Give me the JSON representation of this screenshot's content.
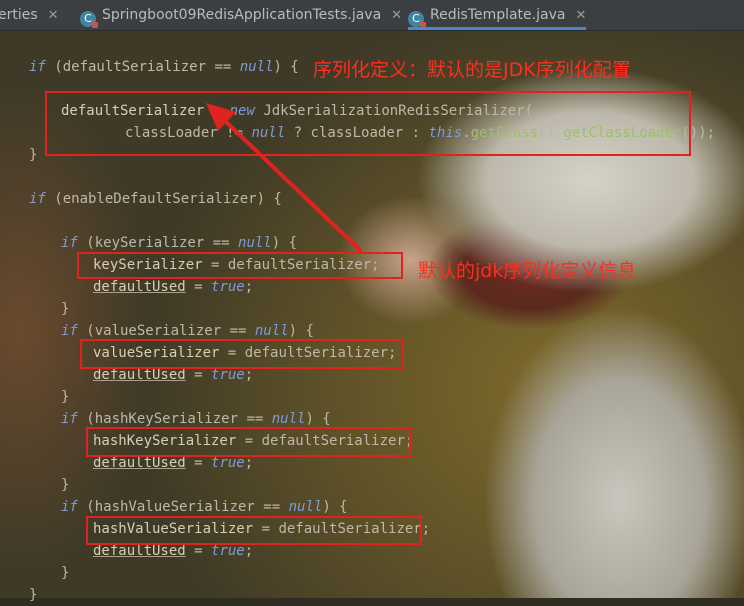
{
  "tabs": [
    {
      "label": "erties",
      "close": "✕"
    },
    {
      "label": "Springboot09RedisApplicationTests.java",
      "close": "✕",
      "icon": "C"
    },
    {
      "label": "RedisTemplate.java",
      "close": "✕",
      "icon": "C",
      "active": true
    }
  ],
  "code": {
    "l1": [
      "if",
      " (defaultSerializer ",
      "==",
      " ",
      "null",
      ") {"
    ],
    "l2": [
      "defaultSerializer",
      " = ",
      "new",
      " JdkSerializationRedisSerializer("
    ],
    "l3": [
      "classLoader",
      " ",
      "!=",
      " ",
      "null",
      " ? classLoader : ",
      "this",
      ".",
      "getClass",
      "().",
      "getClassLoader",
      "());"
    ],
    "l4": "}",
    "l5": [
      "if",
      " (enableDefaultSerializer) {"
    ],
    "l6": [
      "if",
      " (keySerializer ",
      "==",
      " ",
      "null",
      ") {"
    ],
    "l7": [
      "keySerializer",
      " = defaultSerializer;"
    ],
    "l8": [
      "defaultUsed",
      " = ",
      "true",
      ";"
    ],
    "l9": "}",
    "l10": [
      "if",
      " (valueSerializer ",
      "==",
      " ",
      "null",
      ") {"
    ],
    "l11": [
      "valueSerializer",
      " = defaultSerializer;"
    ],
    "l12": [
      "defaultUsed",
      " = ",
      "true",
      ";"
    ],
    "l13": "}",
    "l14": [
      "if",
      " (hashKeySerializer ",
      "==",
      " ",
      "null",
      ") {"
    ],
    "l15": [
      "hashKeySerializer",
      " = defaultSerializer;"
    ],
    "l16": [
      "defaultUsed",
      " = ",
      "true",
      ";"
    ],
    "l17": "}",
    "l18": [
      "if",
      " (hashValueSerializer ",
      "==",
      " ",
      "null",
      ") {"
    ],
    "l19": [
      "hashValueSerializer",
      " = defaultSerializer;"
    ],
    "l20": [
      "defaultUsed",
      " = ",
      "true",
      ";"
    ],
    "l21": "}",
    "l22": "}"
  },
  "annotations": {
    "top": "序列化定义：默认的是JDK序列化配置",
    "middle": "默认的jdk序列化定义信息"
  },
  "colors": {
    "highlight_box": "#e0231f",
    "annotation_text": "#ff2d1f"
  }
}
